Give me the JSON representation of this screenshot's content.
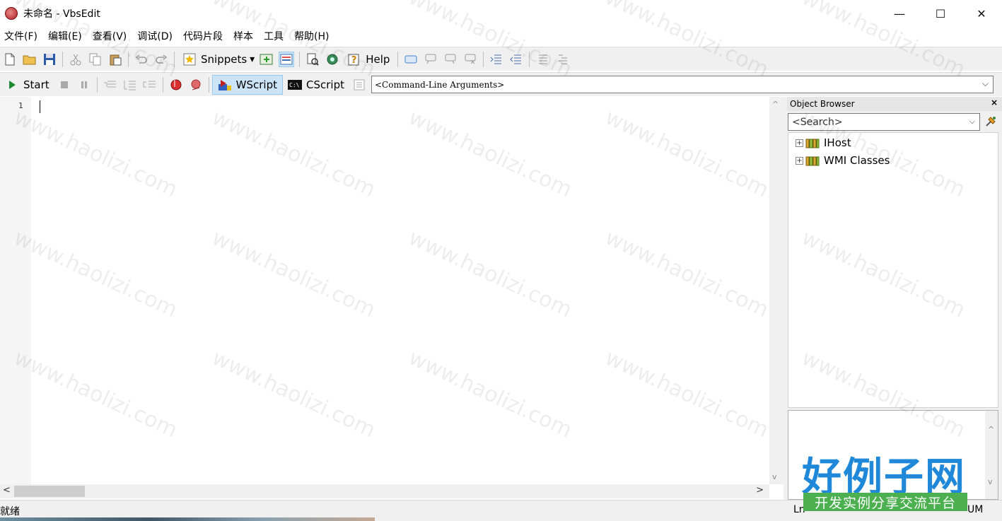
{
  "window": {
    "title": "未命名 - VbsEdit",
    "minimize_glyph": "—",
    "maximize_glyph": "☐",
    "close_glyph": "✕"
  },
  "menu": [
    "文件(F)",
    "编辑(E)",
    "查看(V)",
    "调试(D)",
    "代码片段",
    "样本",
    "工具",
    "帮助(H)"
  ],
  "toolbar1": {
    "snippets_label": "Snippets",
    "snippets_arrow": "▾",
    "help_label": "Help"
  },
  "toolbar2": {
    "start_label": "Start",
    "wscript_label": "WScript",
    "cscript_label": "CScript",
    "cmdline_value": "<Command-Line Arguments>",
    "dropdown_arrow": "⌵"
  },
  "editor": {
    "line_number": "1",
    "scroll_left": "<",
    "scroll_right": ">",
    "scroll_up": "^",
    "scroll_down": "v"
  },
  "object_browser": {
    "title": "Object Browser",
    "close_glyph": "×",
    "search_placeholder": "<Search>",
    "dropdown_arrow": "⌵",
    "tree": [
      {
        "label": "IHost",
        "expander": "+"
      },
      {
        "label": "WMI Classes",
        "expander": "+"
      }
    ]
  },
  "status": {
    "text": "就绪",
    "position": "Ln",
    "num": "UM"
  },
  "watermark": {
    "text": "www.haolizi.com",
    "logo_main": "好例子网",
    "logo_sub": "开发实例分享交流平台"
  },
  "colors": {
    "toolbar_bg": "#f0f0f0",
    "pressed_bg": "#cce4f7",
    "logo_blue": "#1f88d9",
    "logo_green": "#4caf50"
  }
}
